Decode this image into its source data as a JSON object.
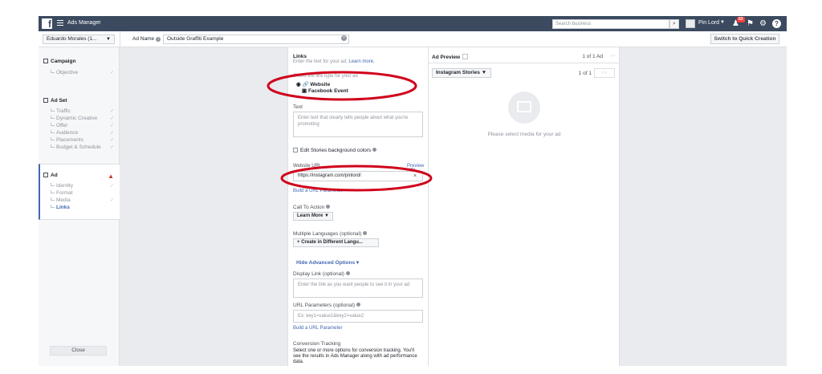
{
  "topbar": {
    "app_title": "Ads Manager",
    "search_placeholder": "Search business",
    "account_name": "Pin Lord",
    "notification_count": "63"
  },
  "subbar": {
    "account_selector": "Eduardo Morales (1...",
    "ad_name_label": "Ad Name",
    "ad_name_value": "Outside Graffiti Example",
    "quick_creation_label": "Switch to Quick Creation"
  },
  "sidebar": {
    "campaign": {
      "label": "Campaign",
      "items": [
        "Objective"
      ]
    },
    "adset": {
      "label": "Ad Set",
      "items": [
        "Traffic",
        "Dynamic Creative",
        "Offer",
        "Audience",
        "Placements",
        "Budget & Schedule"
      ]
    },
    "ad": {
      "label": "Ad",
      "items": [
        "Identity",
        "Format",
        "Media",
        "Links"
      ],
      "active": "Links"
    },
    "close_label": "Close"
  },
  "form": {
    "links_title": "Links",
    "links_subtitle": "Enter the text for your ad.",
    "learn_more": "Learn more.",
    "link_type_label": "Select the link type for your ad",
    "link_type_options": [
      "Website",
      "Facebook Event"
    ],
    "text_label": "Text",
    "text_placeholder": "Enter text that clearly tells people about what you're promoting",
    "stories_bg_label": "Edit Stories background colors",
    "website_url_label": "Website URL",
    "preview_url": "Preview URL",
    "website_url_value": "https://instagram.com/pinlord/",
    "build_url_param": "Build a URL Parameter",
    "cta_label": "Call To Action",
    "cta_value": "Learn More",
    "multi_lang_label": "Multiple Languages (optional)",
    "multi_lang_btn": "Create in Different Langu...",
    "hide_advanced": "Hide Advanced Options",
    "display_link_label": "Display Link (optional)",
    "display_link_placeholder": "Enter the link as you want people to see it in your ad",
    "url_params_label": "URL Parameters (optional)",
    "url_params_placeholder": "Ex: key1=value1&key2=value2",
    "build_url_param2": "Build a URL Parameter",
    "conversion_label": "Conversion Tracking",
    "conversion_text": "Select one or more options for conversion tracking. You'll see the results in Ads Manager along with ad performance data."
  },
  "preview": {
    "title": "Ad Preview",
    "count_top": "1 of 1 Ad",
    "placement": "Instagram Stories",
    "count_sub": "1 of 1",
    "empty_message": "Please select media for your ad"
  },
  "colors": {
    "topbar": "#3b4a5f",
    "link": "#4267b2",
    "annotation": "#d0021b"
  }
}
